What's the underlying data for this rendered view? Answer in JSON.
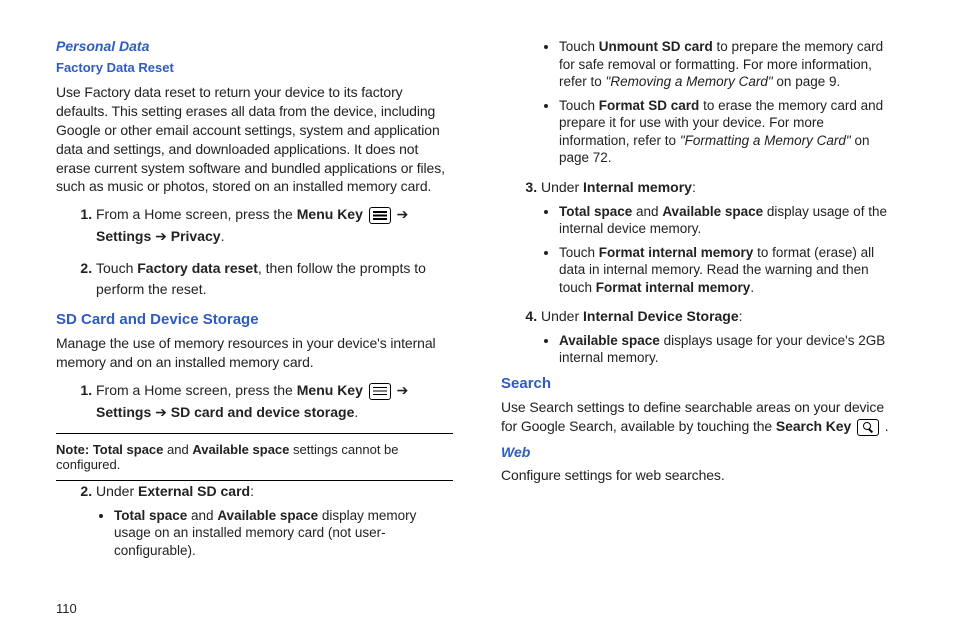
{
  "pageNumber": "110",
  "left": {
    "h_personal": "Personal Data",
    "h_factory": "Factory Data Reset",
    "factory_intro": "Use Factory data reset to return your device to its factory defaults. This setting erases all data from the device, including Google or other email account settings, system and application data and settings, and downloaded applications. It does not erase current system software and bundled applications or files, such as music or photos, stored on an installed memory card.",
    "step1_a": "From a Home screen, press the ",
    "step1_b": "Menu Key",
    "step1_c": " ➔ ",
    "step1_d": "Settings",
    "step1_e": " ➔ ",
    "step1_f": "Privacy",
    "step1_g": ".",
    "step2_a": "Touch ",
    "step2_b": "Factory data reset",
    "step2_c": ", then follow the prompts to perform the reset.",
    "h_sd": "SD Card and Device Storage",
    "sd_intro": "Manage the use of memory resources in your device's internal memory and on an installed memory card.",
    "sd1_a": "From a Home screen, press the ",
    "sd1_b": "Menu Key",
    "sd1_c": " ➔ ",
    "sd1_d": "Settings",
    "sd1_e": " ➔ ",
    "sd1_f": "SD card and device storage",
    "sd1_g": ".",
    "note_a": "Note: Total space",
    "note_b": " and ",
    "note_c": "Available space",
    "note_d": " settings cannot be configured."
  },
  "right": {
    "s2_a": "Under ",
    "s2_b": "External SD card",
    "s2_c": ":",
    "b1_a": "Total space",
    "b1_b": " and ",
    "b1_c": "Available space",
    "b1_d": " display memory usage on an installed memory card (not user-configurable).",
    "b2_a": "Touch ",
    "b2_b": "Unmount SD card",
    "b2_c": " to prepare the memory card for safe removal or formatting. For more information, refer to ",
    "b2_d": "\"Removing a Memory Card\"",
    "b2_e": "  on page 9.",
    "b3_a": "Touch ",
    "b3_b": "Format SD card",
    "b3_c": " to erase the memory card and prepare it for use with your device. For more information, refer to ",
    "b3_d": "\"Formatting a Memory Card\"",
    "b3_e": "  on page 72.",
    "s3_a": "Under ",
    "s3_b": "Internal memory",
    "s3_c": ":",
    "b4_a": "Total space",
    "b4_b": " and ",
    "b4_c": "Available space",
    "b4_d": " display usage of the internal device memory.",
    "b5_a": "Touch ",
    "b5_b": "Format internal memory",
    "b5_c": " to format (erase) all data in internal memory. Read the warning and then touch ",
    "b5_d": "Format internal memory",
    "b5_e": ".",
    "s4_a": "Under ",
    "s4_b": "Internal Device Storage",
    "s4_c": ":",
    "b6_a": "Available space",
    "b6_b": " displays usage for your device's 2GB internal memory.",
    "h_search": "Search",
    "search_a": "Use Search settings to define searchable areas on your device for Google Search, available by touching the ",
    "search_b": "Search Key",
    "search_c": " .",
    "h_web": "Web",
    "web_text": "Configure settings for web searches."
  }
}
